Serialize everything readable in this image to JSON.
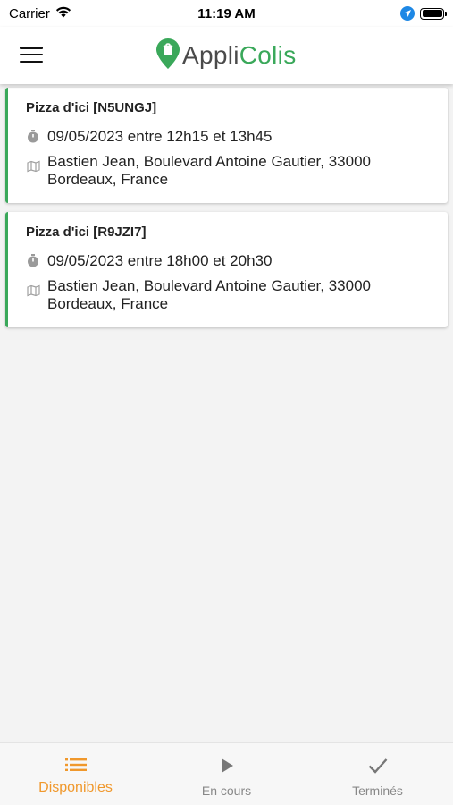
{
  "status_bar": {
    "carrier": "Carrier",
    "time": "11:19 AM"
  },
  "header": {
    "logo_part1": "Appli",
    "logo_part2": "Colis",
    "logo_color": "#3aa85a"
  },
  "orders": [
    {
      "title": "Pizza d'ici [N5UNGJ]",
      "schedule": "09/05/2023 entre 12h15 et 13h45",
      "address_line1": "Bastien Jean, Boulevard Antoine Gautier, 33000",
      "address_line2": "Bordeaux, France"
    },
    {
      "title": "Pizza d'ici [R9JZI7]",
      "schedule": "09/05/2023 entre 18h00 et 20h30",
      "address_line1": "Bastien Jean, Boulevard Antoine Gautier, 33000",
      "address_line2": "Bordeaux, France"
    }
  ],
  "tabs": [
    {
      "label": "Disponibles",
      "icon": "list-icon",
      "active": true
    },
    {
      "label": "En cours",
      "icon": "play-icon",
      "active": false
    },
    {
      "label": "Terminés",
      "icon": "check-icon",
      "active": false
    }
  ],
  "colors": {
    "accent_green": "#3aa85a",
    "active_tab": "#f0982c",
    "inactive_tab": "#888888"
  }
}
